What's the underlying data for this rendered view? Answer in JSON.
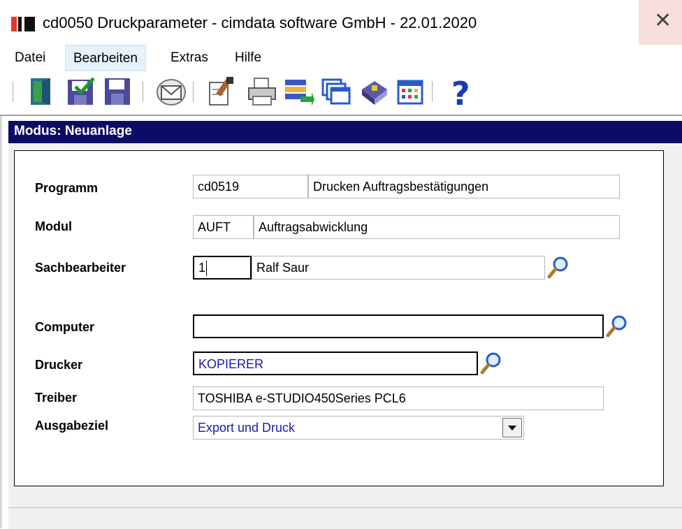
{
  "window": {
    "title": "cd0050 Druckparameter - cimdata software GmbH - 22.01.2020",
    "close_glyph": "✕"
  },
  "menu": {
    "items": [
      {
        "label": "Datei"
      },
      {
        "label": "Bearbeiten",
        "active": true
      },
      {
        "label": "Extras"
      },
      {
        "label": "Hilfe"
      }
    ]
  },
  "toolbar": {
    "icons": [
      "exit-door-icon",
      "save-check-icon",
      "save-icon",
      "mail-icon",
      "edit-document-icon",
      "printer-icon",
      "export-list-icon",
      "windows-icon",
      "book-icon",
      "calendar-grid-icon",
      "help-icon"
    ],
    "help_glyph": "?"
  },
  "mode": {
    "label": "Modus: Neuanlage",
    "bar_color": "#0c0c66"
  },
  "form": {
    "programm": {
      "label": "Programm",
      "code": "cd0519",
      "name": "Drucken Auftragsbestätigungen"
    },
    "modul": {
      "label": "Modul",
      "code": "AUFT",
      "name": "Auftragsabwicklung"
    },
    "sachbearbeiter": {
      "label": "Sachbearbeiter",
      "code": "1",
      "name": "Ralf Saur"
    },
    "computer": {
      "label": "Computer",
      "value": ""
    },
    "drucker": {
      "label": "Drucker",
      "value": "KOPIERER"
    },
    "treiber": {
      "label": "Treiber",
      "value": "TOSHIBA e-STUDIO450Series PCL6"
    },
    "ausgabeziel": {
      "label": "Ausgabeziel",
      "value": "Export und Druck"
    }
  },
  "colors": {
    "accent_text": "#1a1ab0",
    "close_hover": "#f9dede"
  }
}
